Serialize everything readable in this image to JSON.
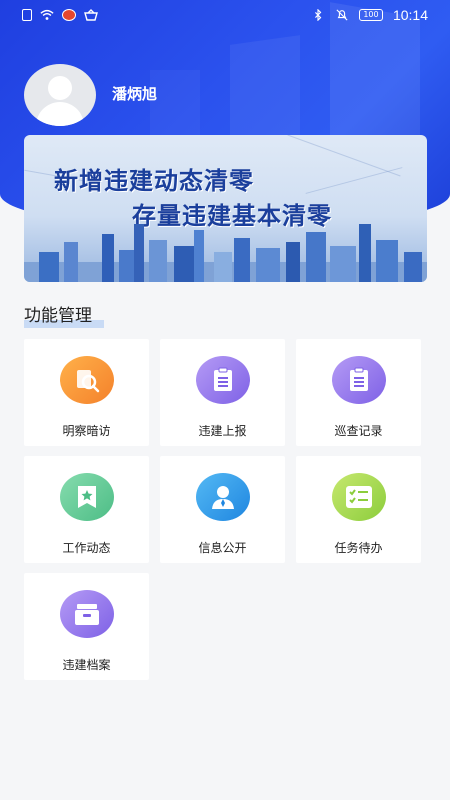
{
  "status_bar": {
    "time": "10:14",
    "battery": "100",
    "icons": [
      "sim-icon",
      "wifi-icon",
      "weibo-icon",
      "basket-icon",
      "bluetooth-icon",
      "mute-icon",
      "battery-icon"
    ]
  },
  "profile": {
    "name": "潘炳旭"
  },
  "banner": {
    "line1": "新增违建动态清零",
    "line2": "存量违建基本清零"
  },
  "section": {
    "title": "功能管理"
  },
  "functions": [
    {
      "label": "明察暗访",
      "icon": "search-document-icon",
      "color": "#f4812b"
    },
    {
      "label": "违建上报",
      "icon": "clipboard-icon",
      "color": "#7e61e6"
    },
    {
      "label": "巡查记录",
      "icon": "clipboard-icon",
      "color": "#7e61e6"
    },
    {
      "label": "工作动态",
      "icon": "star-bookmark-icon",
      "color": "#4dbd86"
    },
    {
      "label": "信息公开",
      "icon": "person-icon",
      "color": "#1f86e0"
    },
    {
      "label": "任务待办",
      "icon": "checklist-icon",
      "color": "#8ccd3c"
    },
    {
      "label": "违建档案",
      "icon": "archive-box-icon",
      "color": "#7e61e6"
    }
  ]
}
